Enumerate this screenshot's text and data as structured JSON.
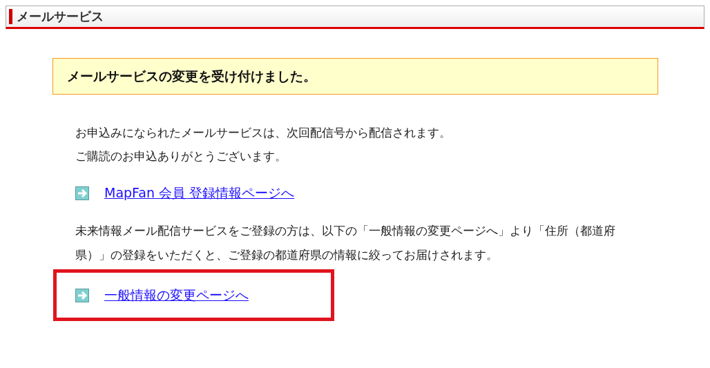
{
  "header": {
    "title": "メールサービス"
  },
  "notice": {
    "message": "メールサービスの変更を受け付けました。"
  },
  "intro": [
    "お申込みになられたメールサービスは、次回配信号から配信されます。",
    "ご購読のお申込ありがとうございます。"
  ],
  "links": [
    {
      "label": "MapFan 会員 登録情報ページへ",
      "highlighted": false,
      "description": "未来情報メール配信サービスをご登録の方は、以下の「一般情報の変更ページへ」より「住所（都道府県）」の登録をいただくと、ご登録の都道府県の情報に絞ってお届けされます。"
    },
    {
      "label": "一般情報の変更ページへ",
      "highlighted": true
    }
  ]
}
